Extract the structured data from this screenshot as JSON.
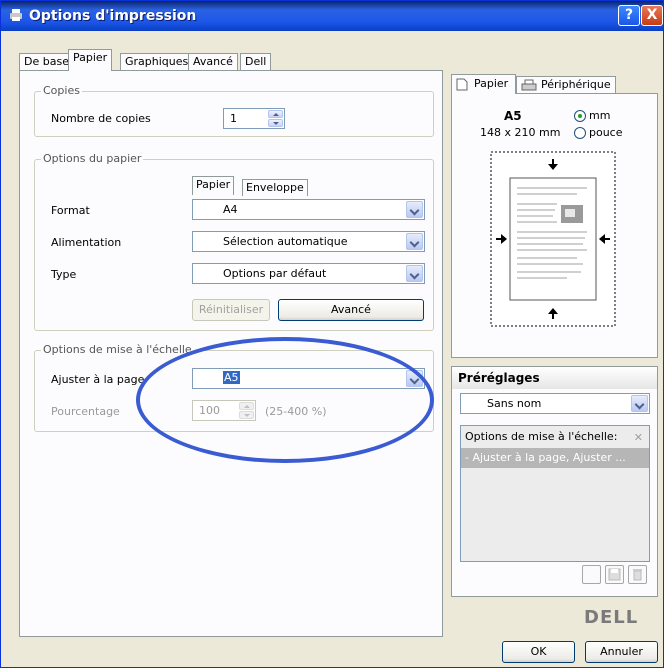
{
  "window": {
    "title": "Options d'impression",
    "help_glyph": "?",
    "close_glyph": "X"
  },
  "tabs": [
    "De base",
    "Papier",
    "Graphiques",
    "Avancé",
    "Dell"
  ],
  "copies": {
    "group_title": "Copies",
    "label": "Nombre de copies",
    "value": "1"
  },
  "paper_options": {
    "group_title": "Options du papier",
    "subtabs": [
      "Papier",
      "Enveloppe"
    ],
    "format_label": "Format",
    "format_value": "A4",
    "source_label": "Alimentation",
    "source_value": "Sélection automatique",
    "type_label": "Type",
    "type_value": "Options par défaut",
    "reset_label": "Réinitialiser",
    "advanced_label": "Avancé"
  },
  "scaling": {
    "group_title": "Options de mise à l'échelle",
    "fit_label": "Ajuster à la page",
    "fit_value": "A5",
    "percent_label": "Pourcentage",
    "percent_value": "100",
    "percent_range": "(25-400 %)"
  },
  "preview": {
    "tabs": [
      "Papier",
      "Périphérique"
    ],
    "size_name": "A5",
    "size_dims": "148 x 210 mm",
    "unit_mm": "mm",
    "unit_inch": "pouce"
  },
  "presets": {
    "title": "Préréglages",
    "selected": "Sans nom",
    "list_header": "Options de mise à l'échelle:",
    "list_item": "- Ajuster à la page, Ajuster ...",
    "remove_glyph": "✕"
  },
  "logo": "DELL",
  "footer": {
    "ok": "OK",
    "cancel": "Annuler"
  },
  "colors": {
    "titlebar": "#1c56e8",
    "dialog_bg": "#ece9d8",
    "highlight_oval": "#3a5bd1"
  }
}
